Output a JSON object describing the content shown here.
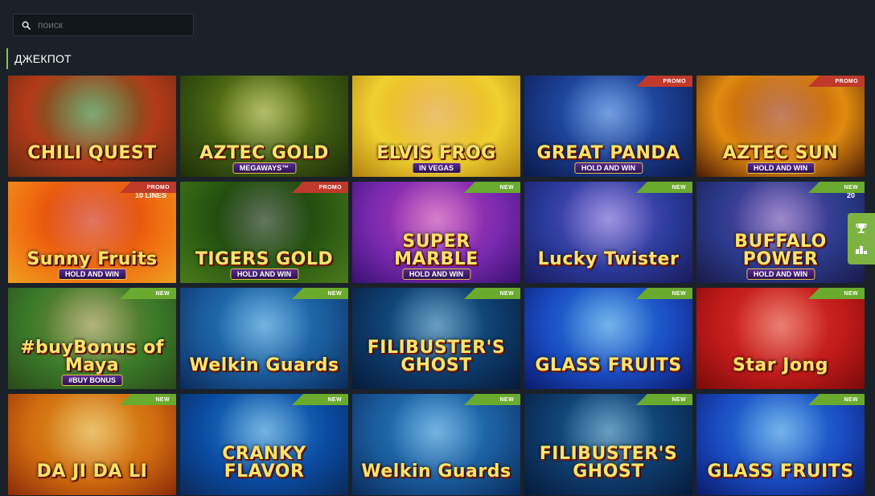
{
  "search": {
    "placeholder": "поиск",
    "value": ""
  },
  "section": {
    "title": "ДЖЕКПОТ"
  },
  "colors": {
    "accent": "#8cc63f",
    "promo": "#c0392b",
    "new": "#6aaa2e",
    "background": "#1b2128"
  },
  "games": [
    {
      "title": "CHILI QUEST",
      "subtitle": "",
      "badge": "",
      "extra": "",
      "bg": [
        "#b23a1a",
        "#3a7a2a",
        "#6a2a10"
      ]
    },
    {
      "title": "AZTEC GOLD",
      "subtitle": "MEGAWAYS™",
      "badge": "",
      "extra": "",
      "bg": [
        "#3d5a12",
        "#8a9a1a",
        "#1e2e08"
      ]
    },
    {
      "title": "ELVIS FROG",
      "subtitle": "IN VEGAS",
      "badge": "",
      "extra": "",
      "bg": [
        "#f0d030",
        "#e0a020",
        "#b08010"
      ]
    },
    {
      "title": "GREAT PANDA",
      "subtitle": "HOLD AND WIN",
      "badge": "PROMO",
      "extra": "",
      "bg": [
        "#1a3a8a",
        "#2a6ad0",
        "#0a1a4a"
      ]
    },
    {
      "title": "AZTEC SUN",
      "subtitle": "HOLD AND WIN",
      "badge": "PROMO",
      "extra": "",
      "bg": [
        "#e08a10",
        "#a03a08",
        "#4a1a04"
      ]
    },
    {
      "title": "Sunny Fruits",
      "subtitle": "HOLD AND WIN",
      "badge": "PROMO",
      "extra": "10 LINES",
      "bg": [
        "#f06a10",
        "#d02a08",
        "#f0a020"
      ]
    },
    {
      "title": "TIGERS GOLD",
      "subtitle": "HOLD AND WIN",
      "badge": "PROMO",
      "extra": "",
      "bg": [
        "#2a5a12",
        "#0e2a08",
        "#4a7a1a"
      ]
    },
    {
      "title": "SUPER MARBLE",
      "subtitle": "HOLD AND WIN",
      "badge": "NEW",
      "extra": "",
      "bg": [
        "#7a2ab0",
        "#c03ab0",
        "#3a1070"
      ]
    },
    {
      "title": "Lucky Twister",
      "subtitle": "",
      "badge": "NEW",
      "extra": "",
      "bg": [
        "#2a3a9a",
        "#6a5ad0",
        "#1a1a5a"
      ]
    },
    {
      "title": "BUFFALO POWER",
      "subtitle": "HOLD AND WIN",
      "badge": "NEW",
      "extra": "20",
      "bg": [
        "#2a3a8a",
        "#6a4ab0",
        "#1a1a4a"
      ]
    },
    {
      "title": "#buyBonus of Maya",
      "subtitle": "#BUY BONUS",
      "badge": "NEW",
      "extra": "",
      "bg": [
        "#3a7a2a",
        "#8a8a3a",
        "#2a4a1a"
      ]
    },
    {
      "title": "Welkin Guards",
      "subtitle": "",
      "badge": "NEW",
      "extra": "",
      "bg": [
        "#1a5a9a",
        "#2a8ad0",
        "#0a2a5a"
      ]
    },
    {
      "title": "FILIBUSTER'S GHOST",
      "subtitle": "",
      "badge": "NEW",
      "extra": "",
      "bg": [
        "#0e3a6a",
        "#1a6aa0",
        "#061a3a"
      ]
    },
    {
      "title": "GLASS FRUITS",
      "subtitle": "",
      "badge": "NEW",
      "extra": "",
      "bg": [
        "#1a4ac0",
        "#2a8ae0",
        "#0a1a6a"
      ]
    },
    {
      "title": "Star Jong",
      "subtitle": "",
      "badge": "NEW",
      "extra": "",
      "bg": [
        "#c01a1a",
        "#e03a2a",
        "#7a0a0a"
      ]
    },
    {
      "title": "DA JI DA LI",
      "subtitle": "",
      "badge": "NEW",
      "extra": "",
      "bg": [
        "#d06a10",
        "#e0a020",
        "#8a2a08"
      ]
    },
    {
      "title": "CRANKY FLAVOR",
      "subtitle": "",
      "badge": "NEW",
      "extra": "",
      "bg": [
        "#0a4aa0",
        "#2a8ad0",
        "#0a2a5a"
      ]
    },
    {
      "title": "Welkin Guards",
      "subtitle": "",
      "badge": "NEW",
      "extra": "",
      "bg": [
        "#1a5a9a",
        "#2a8ad0",
        "#0a2a5a"
      ]
    },
    {
      "title": "FILIBUSTER'S GHOST",
      "subtitle": "",
      "badge": "NEW",
      "extra": "",
      "bg": [
        "#0e3a6a",
        "#1a6aa0",
        "#061a3a"
      ]
    },
    {
      "title": "GLASS FRUITS",
      "subtitle": "",
      "badge": "NEW",
      "extra": "",
      "bg": [
        "#1a4ac0",
        "#2a8ae0",
        "#0a1a6a"
      ]
    }
  ],
  "side_widget": {
    "icons": [
      "trophy-icon",
      "leaderboard-icon"
    ]
  }
}
